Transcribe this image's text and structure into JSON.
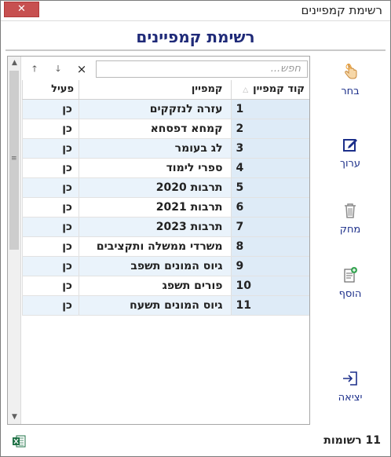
{
  "window": {
    "title": "רשימת קמפיינים",
    "close_label": "✕"
  },
  "heading": "רשימת קמפיינים",
  "search": {
    "placeholder": "חפש..."
  },
  "nav": {
    "up": "🡑",
    "down": "🡓",
    "clear": "×"
  },
  "table": {
    "columns": {
      "code": "קוד קמפיין",
      "name": "קמפיין",
      "active": "פעיל"
    },
    "rows": [
      {
        "code": "1",
        "name": "עזרה לנזקקים",
        "active": "כן"
      },
      {
        "code": "2",
        "name": "קמחא דפסחא",
        "active": "כן"
      },
      {
        "code": "3",
        "name": "לג בעומר",
        "active": "כן"
      },
      {
        "code": "4",
        "name": "ספרי לימוד",
        "active": "כן"
      },
      {
        "code": "5",
        "name": "תרבות 2020",
        "active": "כן"
      },
      {
        "code": "6",
        "name": "תרבות 2021",
        "active": "כן"
      },
      {
        "code": "7",
        "name": "תרבות 2023",
        "active": "כן"
      },
      {
        "code": "8",
        "name": "משרדי ממשלה ותקציבים",
        "active": "כן"
      },
      {
        "code": "9",
        "name": "גיוס המונים תשפב",
        "active": "כן"
      },
      {
        "code": "10",
        "name": "פורים תשפג",
        "active": "כן"
      },
      {
        "code": "11",
        "name": "גיוס המונים תשעח",
        "active": "כן"
      }
    ]
  },
  "sidebar": {
    "select": {
      "label": "בחר",
      "icon": "hand-pointer-icon"
    },
    "edit": {
      "label": "ערוך",
      "icon": "edit-icon"
    },
    "delete": {
      "label": "מחק",
      "icon": "trash-icon"
    },
    "add": {
      "label": "הוסף",
      "icon": "add-document-icon"
    },
    "exit": {
      "label": "יציאה",
      "icon": "exit-icon"
    }
  },
  "status": {
    "records": "11 רשומות"
  },
  "colors": {
    "heading": "#1f2a78",
    "accent": "#1c2f8a",
    "close": "#c75050",
    "row_alt": "#eaf3fb"
  }
}
